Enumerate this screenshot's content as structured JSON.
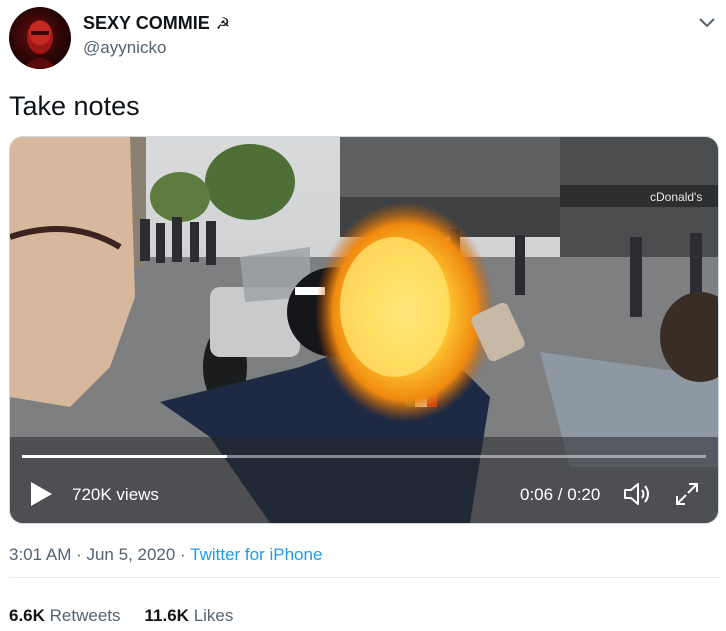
{
  "header": {
    "display_name": "SEXY COMMIE",
    "name_emoji": "☭",
    "handle": "@ayynicko"
  },
  "tweet": {
    "text": "Take notes"
  },
  "video": {
    "views": "720K views",
    "time": "0:06 / 0:20",
    "progress_fraction": 0.3,
    "storefront_sign": "cDonald's"
  },
  "meta": {
    "timestamp": "3:01 AM · Jun 5, 2020 · ",
    "source": "Twitter for iPhone"
  },
  "stats": {
    "retweets_count": "6.6K",
    "retweets_label": "Retweets",
    "likes_count": "11.6K",
    "likes_label": "Likes"
  },
  "colors": {
    "link": "#1d9bf0",
    "secondary_text": "#536471",
    "primary_text": "#0f1419"
  },
  "icons": [
    "chevron-down-icon",
    "hammer-sickle-icon",
    "play-icon",
    "volume-icon",
    "fullscreen-icon"
  ]
}
